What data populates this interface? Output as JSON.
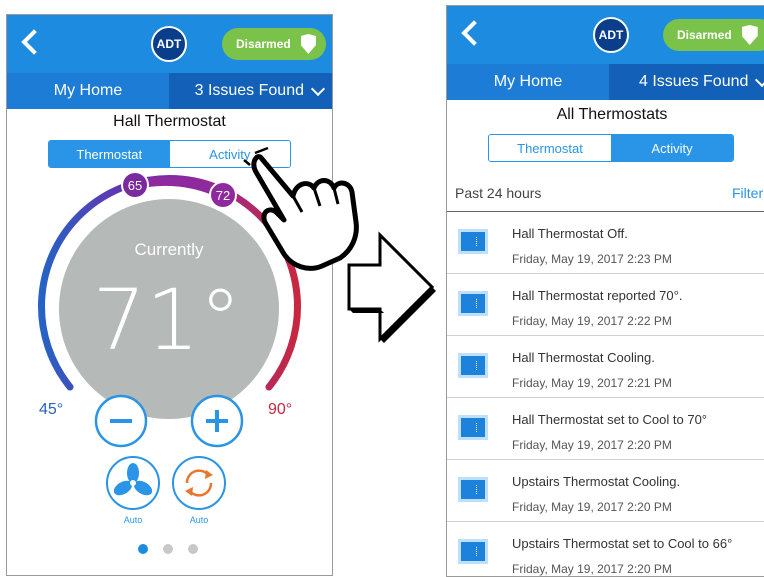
{
  "left_screen": {
    "adt_logo": "ADT",
    "status_label": "Disarmed",
    "home_tab": "My Home",
    "issues_label": "3 Issues Found",
    "device_title": "Hall Thermostat",
    "tab_thermostat": "Thermostat",
    "tab_activity": "Activity",
    "setpoint_low": "65",
    "setpoint_high": "72",
    "current_label": "Currently",
    "current_temp": "71°",
    "range_min": "45°",
    "range_max": "90°",
    "fan_mode": "Auto",
    "system_mode": "Auto",
    "page_dots": {
      "count": 3,
      "active": 0
    }
  },
  "right_screen": {
    "adt_logo": "ADT",
    "status_label": "Disarmed",
    "home_tab": "My Home",
    "issues_label": "4 Issues Found",
    "title": "All Thermostats",
    "tab_thermostat": "Thermostat",
    "tab_activity": "Activity",
    "period_label": "Past 24 hours",
    "filter_label": "Filter",
    "events": [
      {
        "title": "Hall Thermostat Off.",
        "time": "Friday, May 19, 2017   2:23 PM"
      },
      {
        "title": "Hall Thermostat reported 70°.",
        "time": "Friday, May 19, 2017   2:22 PM"
      },
      {
        "title": "Hall Thermostat Cooling.",
        "time": "Friday, May 19, 2017   2:21 PM"
      },
      {
        "title": "Hall Thermostat set to Cool to 70°",
        "time": "Friday, May 19, 2017   2:20 PM"
      },
      {
        "title": "Upstairs Thermostat Cooling.",
        "time": "Friday, May 19, 2017   2:20 PM"
      },
      {
        "title": "Upstairs Thermostat set to Cool to 66°",
        "time": "Friday, May 19, 2017   2:20 PM"
      }
    ]
  },
  "colors": {
    "header_blue": "#1d8ce0",
    "home_bar_blue": "#1260b8",
    "accent_blue": "#2a94e6",
    "disarmed_green": "#7bc24a",
    "dial_gray": "#b5b9b7",
    "setpoint_purple": "#8e2a9e"
  }
}
